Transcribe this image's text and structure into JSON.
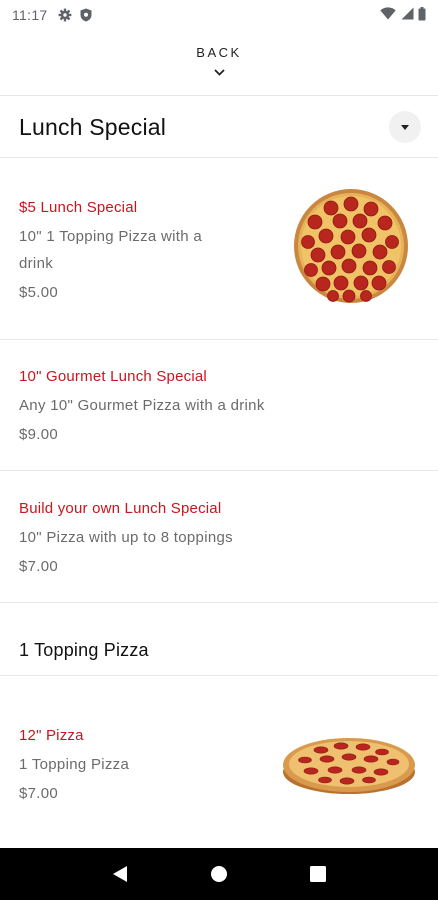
{
  "status_bar": {
    "time": "11:17",
    "icons_left": [
      "gear-icon",
      "shield-icon"
    ],
    "icons_right": [
      "wifi-icon",
      "signal-icon",
      "battery-icon"
    ]
  },
  "header": {
    "back_label": "BACK"
  },
  "section": {
    "title": "Lunch Special"
  },
  "items": [
    {
      "name": "$5 Lunch Special",
      "desc_line1": "10\" 1 Topping Pizza with a",
      "desc_line2": "drink",
      "price": "$5.00",
      "image": "pepperoni-pizza-top-view"
    },
    {
      "name": "10\" Gourmet Lunch Special",
      "desc": "Any 10\" Gourmet Pizza with a drink",
      "price": "$9.00"
    },
    {
      "name": "Build your own Lunch Special",
      "desc": "10\" Pizza with up to 8 toppings",
      "price": "$7.00"
    }
  ],
  "category": {
    "title": "1 Topping Pizza"
  },
  "category_items": [
    {
      "name": "12\" Pizza",
      "desc": "1 Topping Pizza",
      "price": "$7.00",
      "image": "pepperoni-pizza-side-view"
    }
  ],
  "colors": {
    "accent": "#c8161d",
    "muted_text": "#6b6b6b",
    "nav_bar": "#000000"
  }
}
